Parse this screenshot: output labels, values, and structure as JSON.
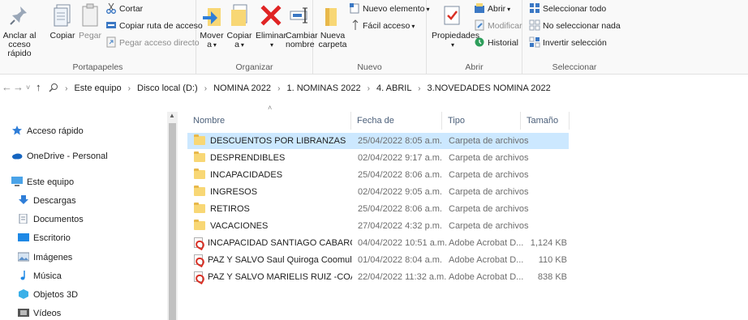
{
  "ribbon": {
    "clipboard": {
      "label": "Portapapeles",
      "pin": "Anclar al\nacceso rápido",
      "pin_line1": "Anclar al",
      "pin_line2": "cceso rápido",
      "copy": "Copiar",
      "paste": "Pegar",
      "cut": "Cortar",
      "copy_path": "Copiar ruta de acceso",
      "paste_shortcut": "Pegar acceso directo"
    },
    "organize": {
      "label": "Organizar",
      "move_line1": "Mover",
      "move_line2": "a",
      "copy_line1": "Copiar",
      "copy_line2": "a",
      "delete": "Eliminar",
      "rename_line1": "Cambiar",
      "rename_line2": "nombre"
    },
    "new": {
      "label": "Nuevo",
      "folder_line1": "Nueva",
      "folder_line2": "carpeta",
      "new_item": "Nuevo elemento",
      "easy_access": "Fácil acceso"
    },
    "open": {
      "label": "Abrir",
      "properties": "Propiedades",
      "open": "Abrir",
      "modify": "Modificar",
      "history": "Historial"
    },
    "select": {
      "label": "Seleccionar",
      "select_all": "Seleccionar todo",
      "select_none": "No seleccionar nada",
      "invert": "Invertir selección"
    }
  },
  "address": {
    "crumbs": [
      "Este equipo",
      "Disco local (D:)",
      "NOMINA 2022",
      "1. NOMINAS 2022",
      "4. ABRIL",
      "3.NOVEDADES NOMINA 2022"
    ]
  },
  "nav": {
    "quick_access": "Acceso rápido",
    "onedrive": "OneDrive - Personal",
    "this_pc": "Este equipo",
    "downloads": "Descargas",
    "documents": "Documentos",
    "desktop": "Escritorio",
    "pictures": "Imágenes",
    "music": "Música",
    "objects3d": "Objetos 3D",
    "videos": "Vídeos"
  },
  "columns": {
    "name": "Nombre",
    "date": "Fecha de modificación",
    "type": "Tipo",
    "size": "Tamaño"
  },
  "files": [
    {
      "name": "DESCUENTOS POR LIBRANZAS",
      "date": "25/04/2022 8:05 a.m.",
      "type": "Carpeta de archivos",
      "size": "",
      "icon": "folder-icon",
      "selected": true
    },
    {
      "name": "DESPRENDIBLES",
      "date": "02/04/2022 9:17 a.m.",
      "type": "Carpeta de archivos",
      "size": "",
      "icon": "folder-icon"
    },
    {
      "name": "INCAPACIDADES",
      "date": "25/04/2022 8:06 a.m.",
      "type": "Carpeta de archivos",
      "size": "",
      "icon": "folder-icon"
    },
    {
      "name": "INGRESOS",
      "date": "02/04/2022 9:05 a.m.",
      "type": "Carpeta de archivos",
      "size": "",
      "icon": "folder-icon"
    },
    {
      "name": "RETIROS",
      "date": "25/04/2022 8:06 a.m.",
      "type": "Carpeta de archivos",
      "size": "",
      "icon": "folder-icon"
    },
    {
      "name": "VACACIONES",
      "date": "27/04/2022 4:32 p.m.",
      "type": "Carpeta de archivos",
      "size": "",
      "icon": "folder-icon"
    },
    {
      "name": "INCAPACIDAD SANTIAGO CABARCAS A...",
      "date": "04/04/2022 10:51 a.m.",
      "type": "Adobe Acrobat D...",
      "size": "1,124 KB",
      "icon": "pdf-icon"
    },
    {
      "name": "PAZ Y SALVO  Saul Quiroga Coomultrasan",
      "date": "01/04/2022 8:04 a.m.",
      "type": "Adobe Acrobat D...",
      "size": "110 KB",
      "icon": "pdf-icon"
    },
    {
      "name": "PAZ Y SALVO MARIELIS RUIZ -COAVICO...",
      "date": "22/04/2022 11:32 a.m.",
      "type": "Adobe Acrobat D...",
      "size": "838 KB",
      "icon": "pdf-icon"
    }
  ],
  "colors": {
    "selection": "#cce8ff",
    "folder": "#f8d775",
    "accent": "#1a73c9"
  }
}
